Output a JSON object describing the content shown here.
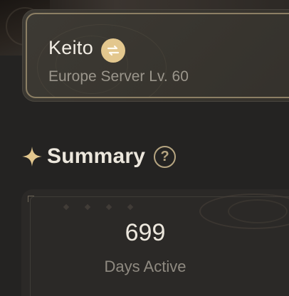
{
  "profile": {
    "player_name": "Keito",
    "server_level": "Europe Server Lv. 60"
  },
  "summary": {
    "title": "Summary",
    "help_symbol": "?"
  },
  "stats": [
    {
      "value": "699",
      "label": "Days Active"
    }
  ],
  "colors": {
    "background": "#242322",
    "card_border": "#8c7f64",
    "accent_gold": "#e3c78e",
    "help_icon": "#b6a581",
    "text_primary": "#ece7dd",
    "text_secondary": "#9b968c"
  },
  "icons": {
    "switch": "swap-arrows-icon",
    "sparkle": "sparkle-icon",
    "help": "question-circle-icon"
  }
}
